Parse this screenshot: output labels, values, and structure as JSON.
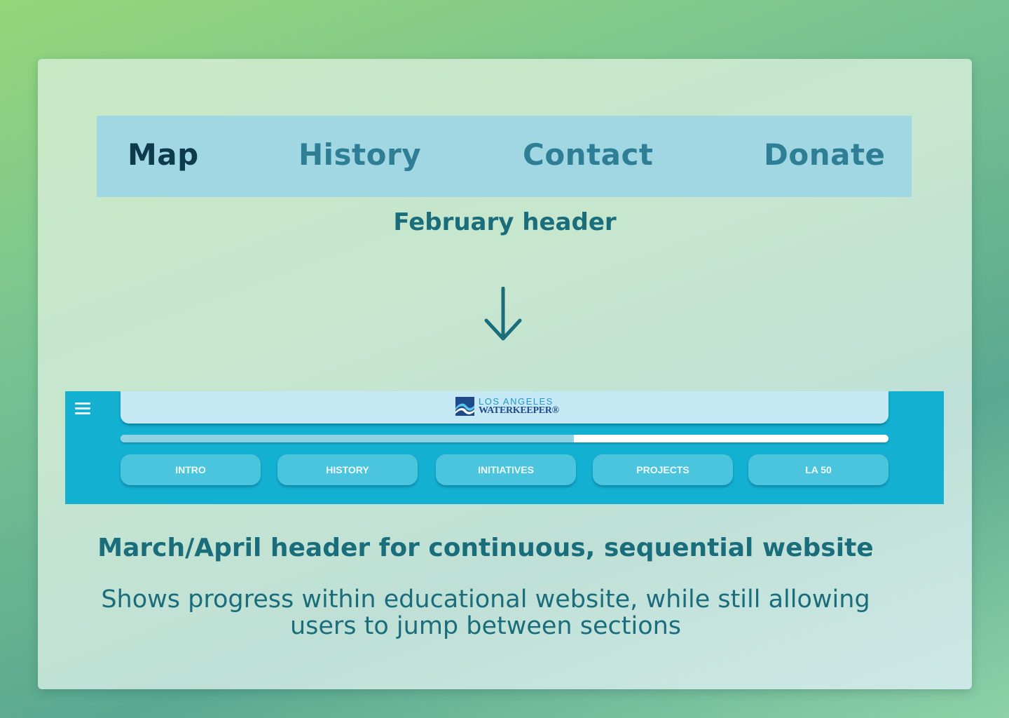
{
  "february_header": {
    "nav_items": [
      "Map",
      "History",
      "Contact",
      "Donate"
    ],
    "active_item": "Map",
    "caption": "February header"
  },
  "march_april_header": {
    "logo": {
      "line1": "LOS ANGELES",
      "line2": "WATERKEEPER®"
    },
    "progress": 0.59,
    "sections": [
      "INTRO",
      "HISTORY",
      "INITIATIVES",
      "PROJECTS",
      "LA 50"
    ],
    "caption": "March/April header for continuous, sequential website"
  },
  "description": {
    "line1": "Shows progress within educational website, while still allowing",
    "line2": "users to jump between sections"
  },
  "colors": {
    "feb_nav_bg": "#a0d7e3",
    "feb_active": "#0e3b4b",
    "feb_inactive": "#2e7e95",
    "ma_header_bg": "#14b0d2",
    "section_button": "#4bc4de",
    "caption_text": "#1a6d7a"
  },
  "icons": {
    "arrow": "arrow-down-icon",
    "menu": "hamburger-menu-icon",
    "logo": "waterkeeper-logo-icon"
  }
}
